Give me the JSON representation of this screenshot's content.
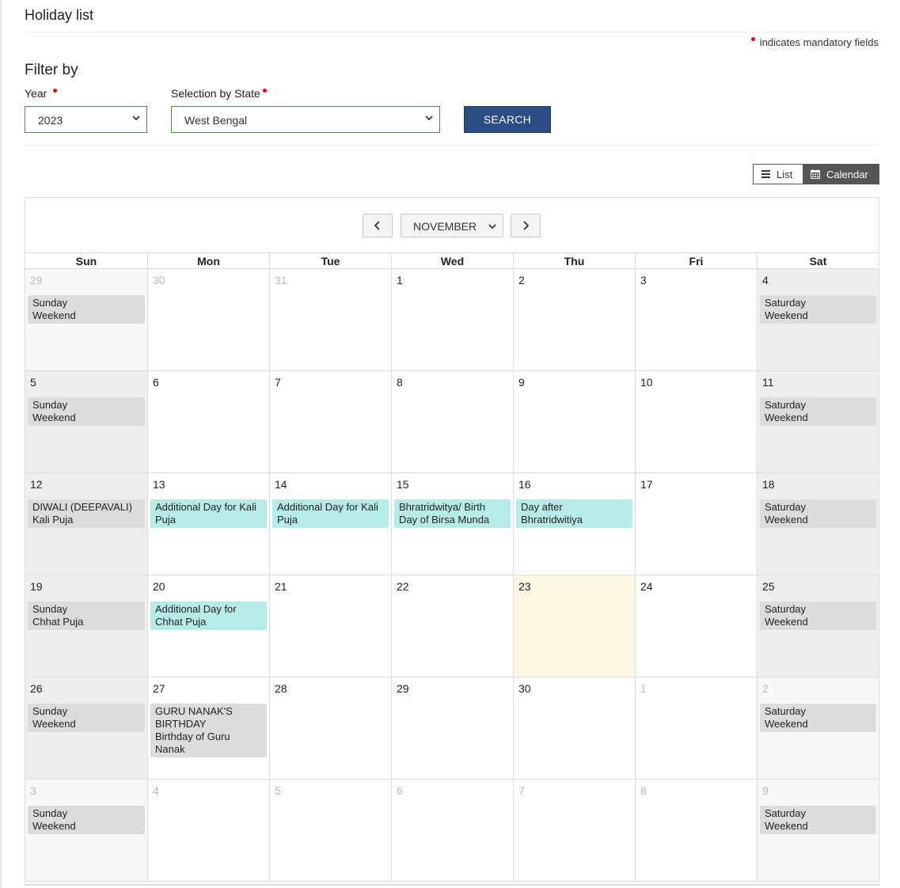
{
  "page": {
    "title": "Holiday list",
    "mandatory_note": "indicates mandatory fields"
  },
  "filter": {
    "title": "Filter by",
    "year_label": "Year",
    "year_value": "2023",
    "state_label": "Selection by State",
    "state_value": "West Bengal",
    "search_label": "SEARCH"
  },
  "view_toggle": {
    "list_label": "List",
    "calendar_label": "Calendar",
    "active": "calendar"
  },
  "calendar": {
    "month": "NOVEMBER",
    "weekdays": [
      "Sun",
      "Mon",
      "Tue",
      "Wed",
      "Thu",
      "Fri",
      "Sat"
    ],
    "today": "23",
    "weeks": [
      [
        {
          "day": "29",
          "other": true,
          "events": [
            {
              "color": "grey",
              "lines": [
                "Sunday",
                "Weekend"
              ]
            }
          ]
        },
        {
          "day": "30",
          "other": true,
          "events": []
        },
        {
          "day": "31",
          "other": true,
          "events": []
        },
        {
          "day": "1",
          "other": false,
          "events": []
        },
        {
          "day": "2",
          "other": false,
          "events": []
        },
        {
          "day": "3",
          "other": false,
          "events": []
        },
        {
          "day": "4",
          "other": false,
          "events": [
            {
              "color": "grey",
              "lines": [
                "Saturday",
                "Weekend"
              ]
            }
          ]
        }
      ],
      [
        {
          "day": "5",
          "other": false,
          "events": [
            {
              "color": "grey",
              "lines": [
                "Sunday",
                "Weekend"
              ]
            }
          ]
        },
        {
          "day": "6",
          "other": false,
          "events": []
        },
        {
          "day": "7",
          "other": false,
          "events": []
        },
        {
          "day": "8",
          "other": false,
          "events": []
        },
        {
          "day": "9",
          "other": false,
          "events": []
        },
        {
          "day": "10",
          "other": false,
          "events": []
        },
        {
          "day": "11",
          "other": false,
          "events": [
            {
              "color": "grey",
              "lines": [
                "Saturday",
                "Weekend"
              ]
            }
          ]
        }
      ],
      [
        {
          "day": "12",
          "other": false,
          "events": [
            {
              "color": "grey",
              "lines": [
                "DIWALI (DEEPAVALI)",
                "Kali Puja"
              ]
            }
          ]
        },
        {
          "day": "13",
          "other": false,
          "events": [
            {
              "color": "teal",
              "lines": [
                "Additional Day for Kali",
                "Puja"
              ]
            }
          ]
        },
        {
          "day": "14",
          "other": false,
          "events": [
            {
              "color": "teal",
              "lines": [
                "Additional Day for Kali",
                "Puja"
              ]
            }
          ]
        },
        {
          "day": "15",
          "other": false,
          "events": [
            {
              "color": "teal",
              "lines": [
                "Bhratridwitya/ Birth",
                "Day of Birsa Munda"
              ]
            }
          ]
        },
        {
          "day": "16",
          "other": false,
          "events": [
            {
              "color": "teal",
              "lines": [
                "Day after",
                "Bhratridwitiya"
              ]
            }
          ]
        },
        {
          "day": "17",
          "other": false,
          "events": []
        },
        {
          "day": "18",
          "other": false,
          "events": [
            {
              "color": "grey",
              "lines": [
                "Saturday",
                "Weekend"
              ]
            }
          ]
        }
      ],
      [
        {
          "day": "19",
          "other": false,
          "events": [
            {
              "color": "grey",
              "lines": [
                "Sunday",
                "Chhat Puja"
              ]
            }
          ]
        },
        {
          "day": "20",
          "other": false,
          "events": [
            {
              "color": "teal",
              "lines": [
                "Additional Day for",
                "Chhat Puja"
              ]
            }
          ]
        },
        {
          "day": "21",
          "other": false,
          "events": []
        },
        {
          "day": "22",
          "other": false,
          "events": []
        },
        {
          "day": "23",
          "other": false,
          "events": []
        },
        {
          "day": "24",
          "other": false,
          "events": []
        },
        {
          "day": "25",
          "other": false,
          "events": [
            {
              "color": "grey",
              "lines": [
                "Saturday",
                "Weekend"
              ]
            }
          ]
        }
      ],
      [
        {
          "day": "26",
          "other": false,
          "events": [
            {
              "color": "grey",
              "lines": [
                "Sunday",
                "Weekend"
              ]
            }
          ]
        },
        {
          "day": "27",
          "other": false,
          "events": [
            {
              "color": "grey",
              "lines": [
                "GURU NANAK'S",
                "BIRTHDAY",
                "Birthday of Guru",
                "Nanak"
              ]
            }
          ]
        },
        {
          "day": "28",
          "other": false,
          "events": []
        },
        {
          "day": "29",
          "other": false,
          "events": []
        },
        {
          "day": "30",
          "other": false,
          "events": []
        },
        {
          "day": "1",
          "other": true,
          "events": []
        },
        {
          "day": "2",
          "other": true,
          "events": [
            {
              "color": "grey",
              "lines": [
                "Saturday",
                "Weekend"
              ]
            }
          ]
        }
      ],
      [
        {
          "day": "3",
          "other": true,
          "events": [
            {
              "color": "grey",
              "lines": [
                "Sunday",
                "Weekend"
              ]
            }
          ]
        },
        {
          "day": "4",
          "other": true,
          "events": []
        },
        {
          "day": "5",
          "other": true,
          "events": []
        },
        {
          "day": "6",
          "other": true,
          "events": []
        },
        {
          "day": "7",
          "other": true,
          "events": []
        },
        {
          "day": "8",
          "other": true,
          "events": []
        },
        {
          "day": "9",
          "other": true,
          "events": [
            {
              "color": "grey",
              "lines": [
                "Saturday",
                "Weekend"
              ]
            }
          ]
        }
      ]
    ]
  }
}
